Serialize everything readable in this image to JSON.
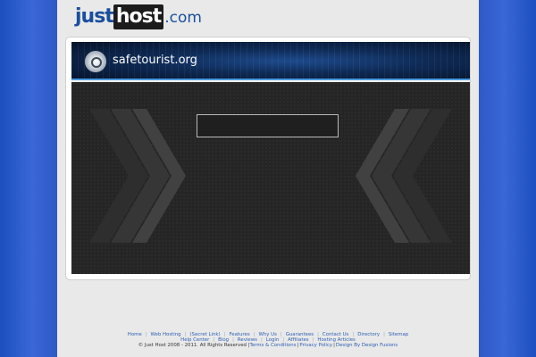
{
  "logo": {
    "just": "just",
    "host": "host",
    "com": ".com"
  },
  "banner": {
    "site_name": "safetourist.org"
  },
  "search": {
    "value": "",
    "placeholder": ""
  },
  "footer": {
    "row1": [
      "Home",
      "Web Hosting",
      "(Secret Link)",
      "Features",
      "Why Us",
      "Guarantees",
      "Contact Us",
      "Directory",
      "Sitemap"
    ],
    "row2": [
      "Help Center",
      "Blog",
      "Reviews",
      "Login",
      "Affiliates",
      "Hosting Articles"
    ],
    "copyright": "© Just Host 2008 - 2011. All Rights Reserved |",
    "terms": "Terms & Conditions",
    "privacy": "Privacy Policy",
    "design": "Design By Design Fusions"
  },
  "colors": {
    "brand_blue": "#1a4f9e",
    "background_blue": "#1d44a6",
    "link_blue": "#2d5fb5"
  }
}
